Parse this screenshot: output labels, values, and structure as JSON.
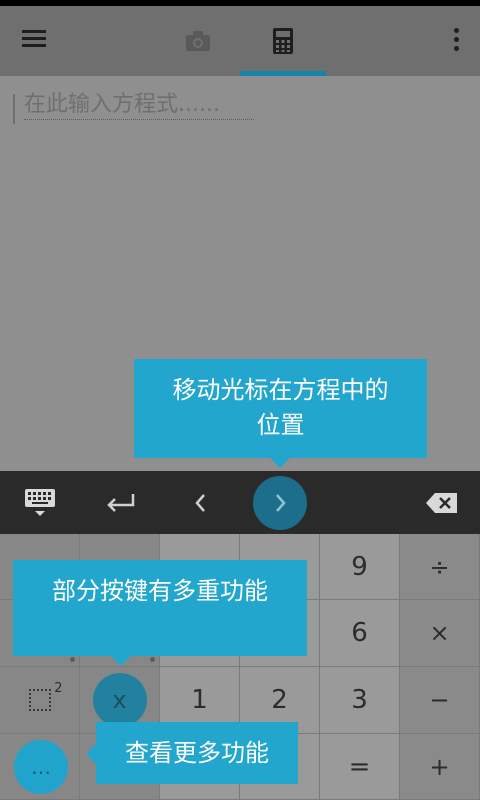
{
  "appbar": {
    "menu_icon": "hamburger-menu-icon",
    "tabs": [
      {
        "icon": "camera-icon",
        "selected": false
      },
      {
        "icon": "calculator-icon",
        "selected": true
      }
    ],
    "more_icon": "more-vert-icon",
    "accent_color": "#1584a6"
  },
  "editor": {
    "placeholder": "在此输入方程式......"
  },
  "tooltips": {
    "cursor_tip": "移动光标在方程中的位置",
    "keys_tip": "部分按键有多重功能",
    "more_tip": "查看更多功能",
    "bubble_color": "#22a6cd"
  },
  "toolbar": {
    "keyboard_icon": "keyboard-hide-icon",
    "enter_icon": "enter-return-icon",
    "left_icon": "chevron-left-icon",
    "right_icon": "chevron-right-icon",
    "backspace_icon": "backspace-icon"
  },
  "keypad": {
    "row1": [
      "9",
      "÷"
    ],
    "row2": [
      "6",
      "×"
    ],
    "row3": [
      "x",
      "1",
      "2",
      "3",
      "−"
    ],
    "row4": [
      "…",
      "=",
      "+"
    ],
    "square_sup": "2"
  }
}
